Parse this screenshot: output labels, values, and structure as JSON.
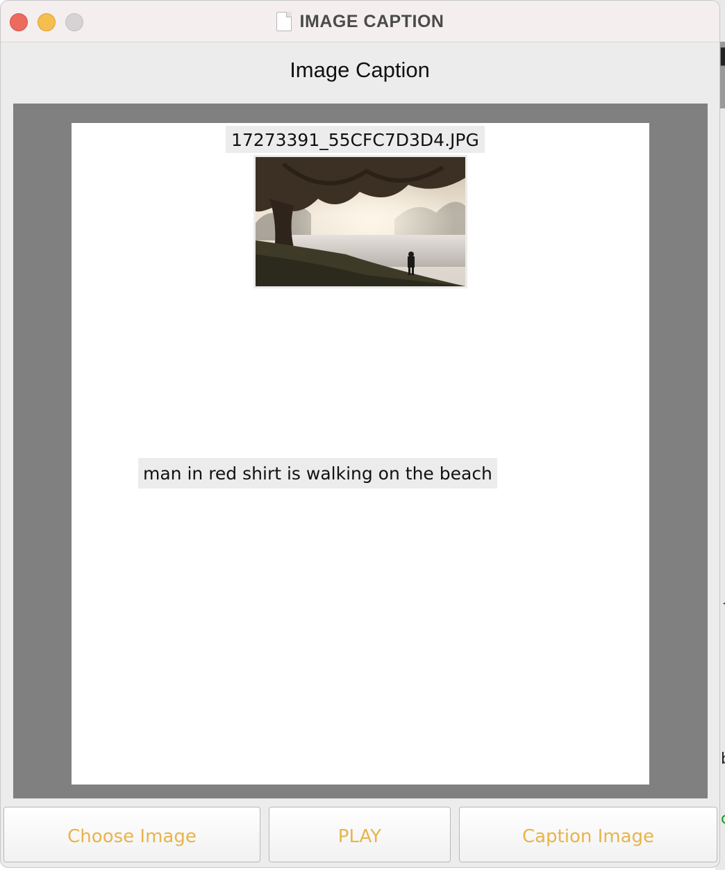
{
  "window": {
    "title": "IMAGE CAPTION"
  },
  "header": {
    "label": "Image Caption"
  },
  "image": {
    "filename": "17273391_55CFC7D3D4.JPG"
  },
  "caption": {
    "text": "man in red shirt is walking on the beach"
  },
  "buttons": {
    "choose_label": "Choose Image",
    "play_label": "PLAY",
    "caption_label": "Caption Image"
  },
  "background_window": {
    "glyphs": [
      "▌",
      "っ",
      "b",
      "c"
    ]
  },
  "colors": {
    "button_text": "#e8b44a",
    "panel": "#808080",
    "window_bg": "#ececec"
  }
}
